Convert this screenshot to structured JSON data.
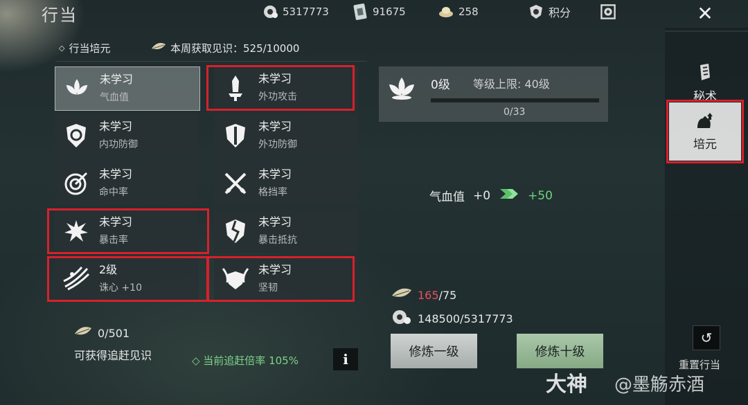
{
  "title": "行当",
  "resources": {
    "coins": "5317773",
    "tickets": "91675",
    "jade": "258",
    "points_label": "积分"
  },
  "header": {
    "section_label": "行当培元",
    "weekly_label": "本周获取见识：525/10000"
  },
  "skills": [
    {
      "status": "未学习",
      "name": "气血值",
      "icon": "lotus-icon"
    },
    {
      "status": "未学习",
      "name": "外功攻击",
      "icon": "blade-icon"
    },
    {
      "status": "未学习",
      "name": "内功防御",
      "icon": "shield-swirl-icon"
    },
    {
      "status": "未学习",
      "name": "外功防御",
      "icon": "shield-icon"
    },
    {
      "status": "未学习",
      "name": "命中率",
      "icon": "target-icon"
    },
    {
      "status": "未学习",
      "name": "格挡率",
      "icon": "crossed-swords-icon"
    },
    {
      "status": "未学习",
      "name": "暴击率",
      "icon": "burst-icon"
    },
    {
      "status": "未学习",
      "name": "暴击抵抗",
      "icon": "cracked-shield-icon"
    },
    {
      "status": "2级",
      "name": "诛心 +10",
      "icon": "claw-icon"
    },
    {
      "status": "未学习",
      "name": "坚韧",
      "icon": "horn-shield-icon"
    }
  ],
  "detail": {
    "level": "0级",
    "level_cap": "等级上限: 40级",
    "progress_text": "0/33",
    "progress": 0,
    "stat_name": "气血值",
    "stat_current": "+0",
    "stat_next": "+50"
  },
  "costs": {
    "insight_have": "165",
    "insight_need": "/75",
    "coin_cost": "148500/5317773"
  },
  "buttons": {
    "train_one": "修炼一级",
    "train_ten": "修炼十级"
  },
  "catchup": {
    "value": "0/501",
    "label": "可获得追赶见识",
    "rate": "◇ 当前追赶倍率 105%",
    "info": "i"
  },
  "side_tabs": {
    "tab1": "秘术",
    "tab2": "培元",
    "reset": "重置行当"
  },
  "watermark": {
    "brand": "大神",
    "author": "@墨觞赤酒"
  },
  "colors": {
    "highlight": "#d9202c",
    "positive": "#6fd37b",
    "insufficient": "#e8505a"
  }
}
